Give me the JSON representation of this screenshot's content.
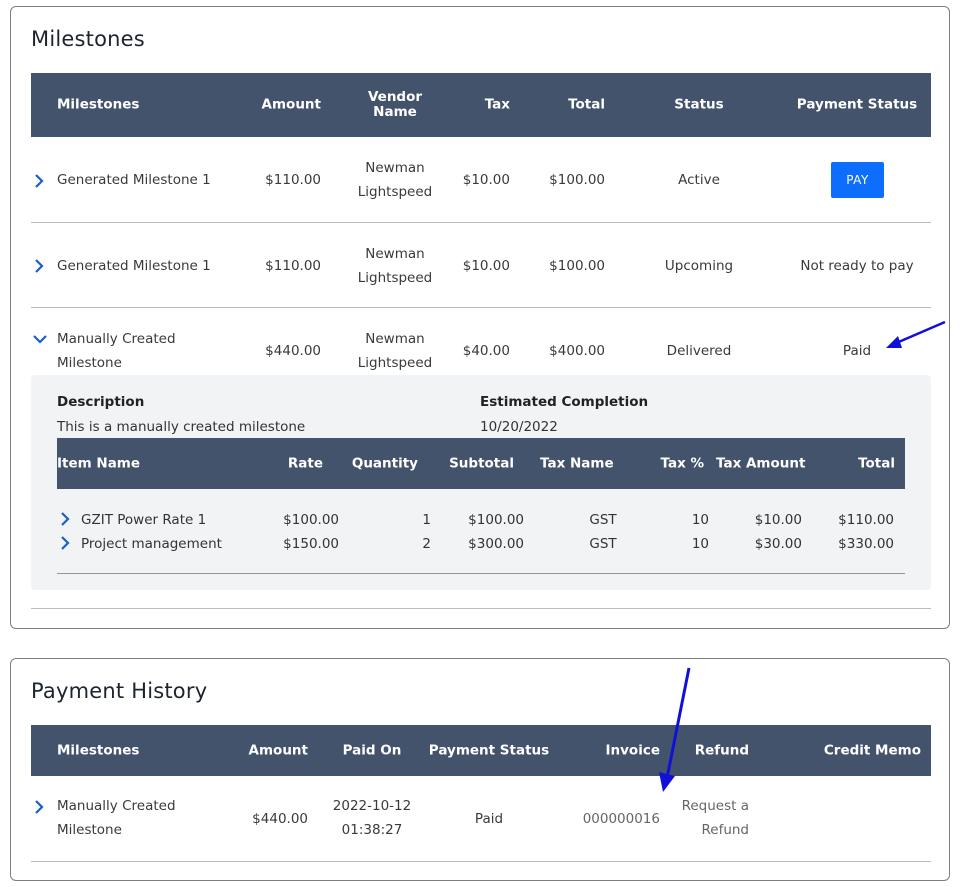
{
  "milestones": {
    "title": "Milestones",
    "headers": {
      "milestone": "Milestones",
      "amount": "Amount",
      "vendor_line1": "Vendor",
      "vendor_line2": "Name",
      "tax": "Tax",
      "total": "Total",
      "status": "Status",
      "payment_status": "Payment Status"
    },
    "rows": [
      {
        "name_line1": "Generated Milestone 1",
        "name_line2": "",
        "amount": "$110.00",
        "vendor_line1": "Newman",
        "vendor_line2": "Lightspeed",
        "tax": "$10.00",
        "total": "$100.00",
        "status": "Active",
        "pay_label": "PAY"
      },
      {
        "name_line1": "Generated Milestone 1",
        "name_line2": "",
        "amount": "$110.00",
        "vendor_line1": "Newman",
        "vendor_line2": "Lightspeed",
        "tax": "$10.00",
        "total": "$100.00",
        "status": "Upcoming",
        "payment_status": "Not ready to pay"
      },
      {
        "name_line1": "Manually Created",
        "name_line2": "Milestone",
        "amount": "$440.00",
        "vendor_line1": "Newman",
        "vendor_line2": "Lightspeed",
        "tax": "$40.00",
        "total": "$400.00",
        "status": "Delivered",
        "payment_status": "Paid"
      }
    ],
    "detail": {
      "description_label": "Description",
      "description_value": "This is a manually created milestone",
      "estimated_label": "Estimated Completion",
      "estimated_value": "10/20/2022",
      "headers": {
        "item_name": "Item Name",
        "rate": "Rate",
        "quantity": "Quantity",
        "subtotal": "Subtotal",
        "tax_name": "Tax Name",
        "tax_pct": "Tax %",
        "tax_amount": "Tax Amount",
        "total": "Total"
      },
      "items": [
        {
          "name": "GZIT Power Rate 1",
          "rate": "$100.00",
          "quantity": "1",
          "subtotal": "$100.00",
          "tax_name": "GST",
          "tax_pct": "10",
          "tax_amount": "$10.00",
          "total": "$110.00"
        },
        {
          "name": "Project management",
          "rate": "$150.00",
          "quantity": "2",
          "subtotal": "$300.00",
          "tax_name": "GST",
          "tax_pct": "10",
          "tax_amount": "$30.00",
          "total": "$330.00"
        }
      ]
    }
  },
  "payment_history": {
    "title": "Payment History",
    "headers": {
      "milestone": "Milestones",
      "amount": "Amount",
      "paid_on": "Paid On",
      "payment_status": "Payment Status",
      "invoice": "Invoice",
      "refund": "Refund",
      "credit_memo": "Credit Memo"
    },
    "rows": [
      {
        "name_line1": "Manually Created",
        "name_line2": "Milestone",
        "amount": "$440.00",
        "paid_on_line1": "2022-10-12",
        "paid_on_line2": "01:38:27",
        "payment_status": "Paid",
        "invoice": "000000016",
        "refund_line1": "Request a",
        "refund_line2": "Refund"
      }
    ]
  },
  "colors": {
    "header_bg": "#43536b",
    "pay_button": "#0d6efd",
    "annotation_arrow": "#1010d8",
    "chevron": "#1a5fc8"
  },
  "icons": {
    "expand": "chevron-right-icon",
    "collapse": "chevron-down-icon",
    "annotation": "arrow-annotation"
  }
}
